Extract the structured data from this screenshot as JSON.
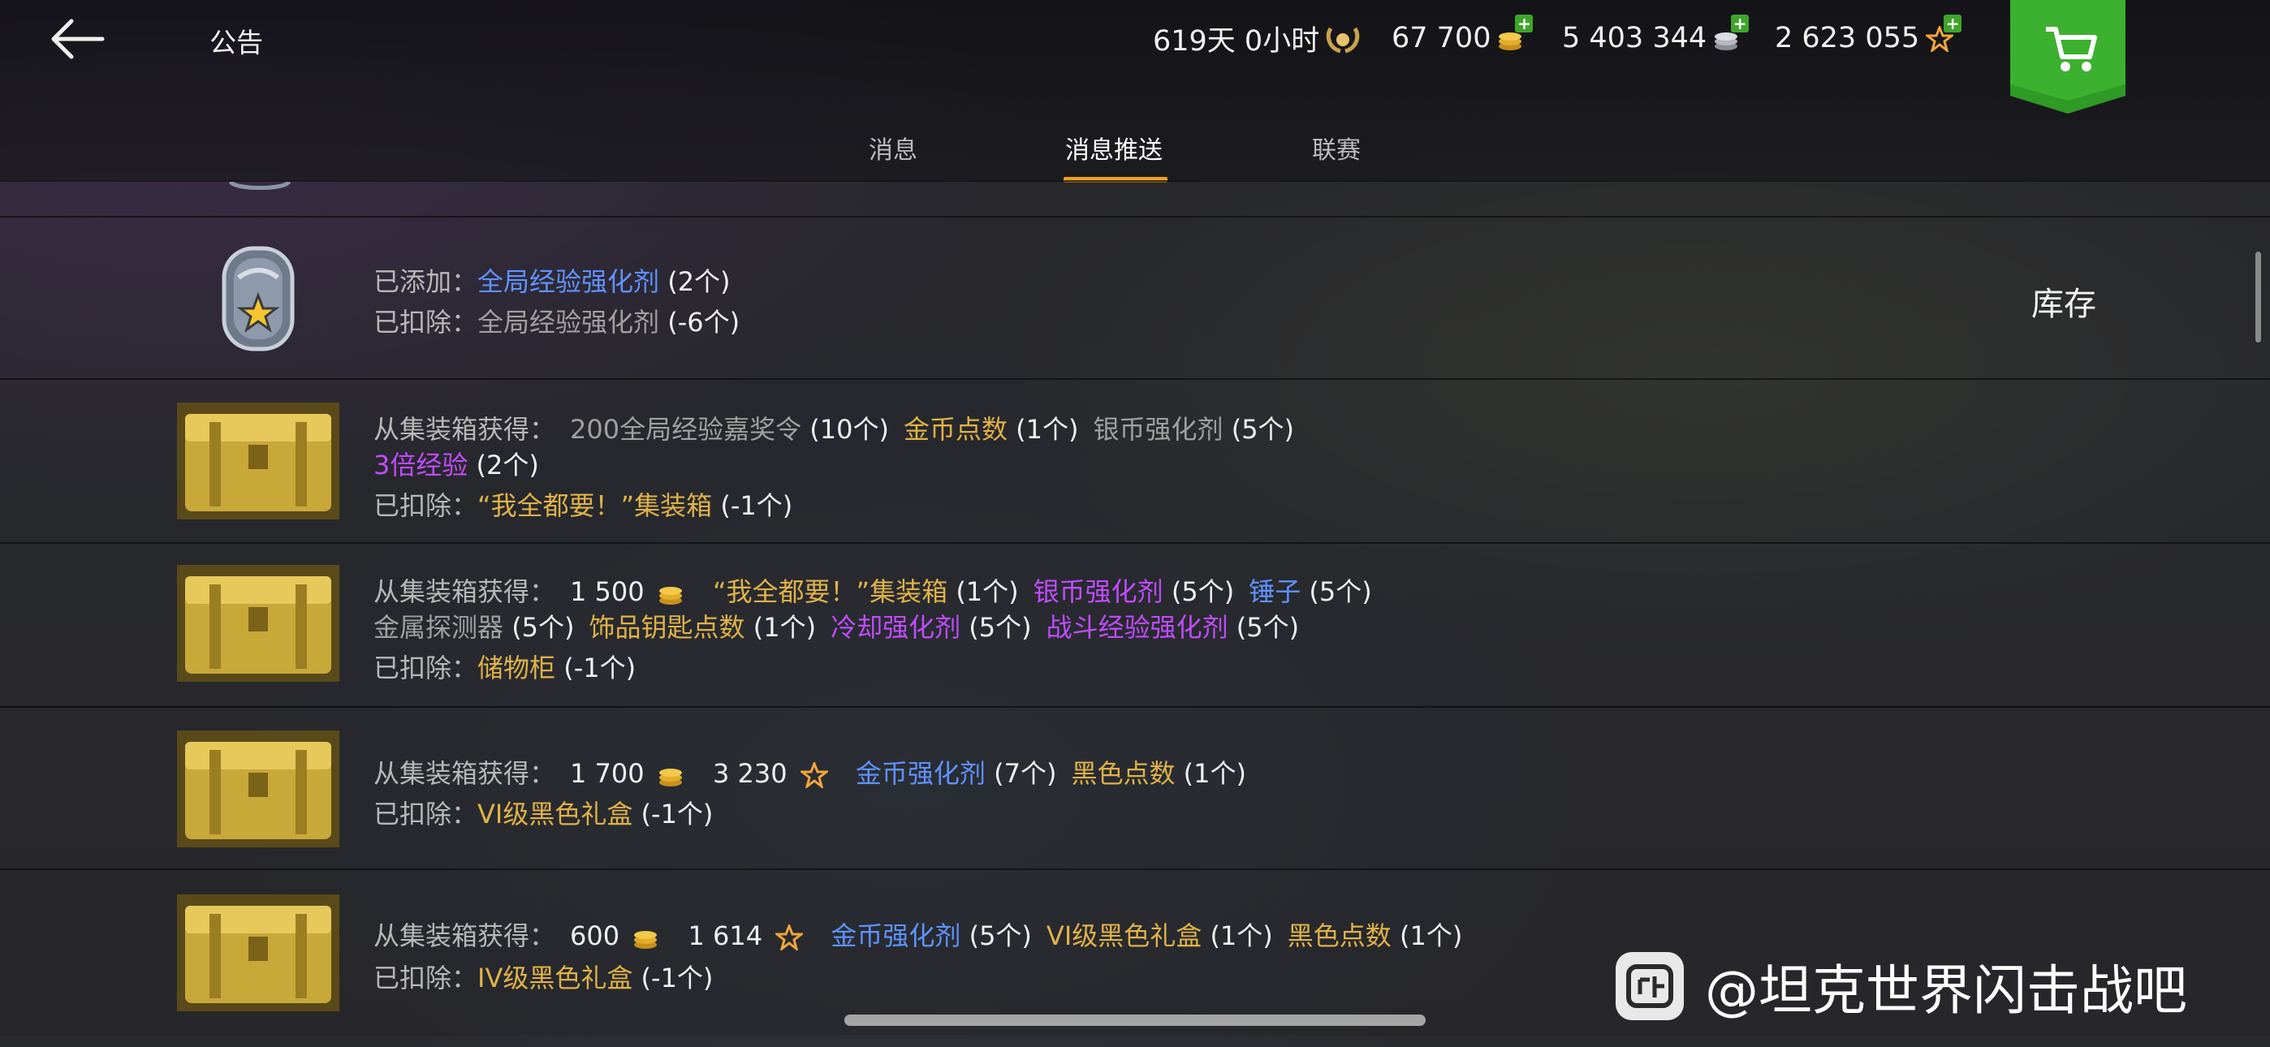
{
  "header": {
    "title": "公告",
    "resources": {
      "premium_time": "619天 0小时",
      "gold": "67 700",
      "silver": "5 403 344",
      "free_xp": "2 623 055"
    }
  },
  "tabs": [
    {
      "label": "消息",
      "active": false
    },
    {
      "label": "消息推送",
      "active": true
    },
    {
      "label": "联赛",
      "active": false
    }
  ],
  "inventory_button": "库存",
  "messages": [
    {
      "lines": [
        [
          {
            "t": "已添加：",
            "c": "lbl"
          },
          {
            "t": "全局经验强化剂",
            "c": "blue"
          },
          {
            "t": " (2个)",
            "c": "white"
          }
        ],
        [
          {
            "t": "已扣除：",
            "c": "lbl"
          },
          {
            "t": "全局经验强化剂",
            "c": "gray"
          },
          {
            "t": " (-6个)",
            "c": "white"
          }
        ]
      ]
    },
    {
      "lines": [
        [
          {
            "t": "从集装箱获得：",
            "c": "lbl"
          },
          {
            "t": "200全局经验嘉奖令",
            "c": "gray"
          },
          {
            "t": " (10个)",
            "c": "white"
          },
          {
            "t": "金币点数",
            "c": "yellow"
          },
          {
            "t": " (1个)",
            "c": "white"
          },
          {
            "t": "银币强化剂",
            "c": "gray"
          },
          {
            "t": " (5个)",
            "c": "white"
          }
        ],
        [
          {
            "t": "3倍经验",
            "c": "purple"
          },
          {
            "t": " (2个)",
            "c": "white"
          }
        ],
        [
          {
            "t": "已扣除：",
            "c": "lbl"
          },
          {
            "t": "“我全都要！”集装箱",
            "c": "yellow"
          },
          {
            "t": " (-1个)",
            "c": "white"
          }
        ]
      ]
    },
    {
      "lines": [
        [
          {
            "t": "从集装箱获得：",
            "c": "lbl"
          },
          {
            "t": "1 500",
            "c": "white",
            "coin": "gold"
          },
          {
            "t": "“我全都要！”集装箱",
            "c": "yellow"
          },
          {
            "t": " (1个)",
            "c": "white"
          },
          {
            "t": "银币强化剂",
            "c": "purple"
          },
          {
            "t": " (5个)",
            "c": "white"
          },
          {
            "t": "锤子",
            "c": "blue"
          },
          {
            "t": " (5个)",
            "c": "white"
          }
        ],
        [
          {
            "t": "金属探测器",
            "c": "gray"
          },
          {
            "t": " (5个)",
            "c": "white"
          },
          {
            "t": "饰品钥匙点数",
            "c": "yellow"
          },
          {
            "t": " (1个)",
            "c": "white"
          },
          {
            "t": "冷却强化剂",
            "c": "purple"
          },
          {
            "t": " (5个)",
            "c": "white"
          },
          {
            "t": "战斗经验强化剂",
            "c": "purple"
          },
          {
            "t": " (5个)",
            "c": "white"
          }
        ],
        [
          {
            "t": "已扣除：",
            "c": "lbl"
          },
          {
            "t": "储物柜",
            "c": "yellow"
          },
          {
            "t": " (-1个)",
            "c": "white"
          }
        ]
      ]
    },
    {
      "lines": [
        [
          {
            "t": "从集装箱获得：",
            "c": "lbl"
          },
          {
            "t": "1 700",
            "c": "white",
            "coin": "gold"
          },
          {
            "t": "3 230",
            "c": "white",
            "coin": "star"
          },
          {
            "t": "金币强化剂",
            "c": "blue"
          },
          {
            "t": " (7个)",
            "c": "white"
          },
          {
            "t": "黑色点数",
            "c": "yellow"
          },
          {
            "t": " (1个)",
            "c": "white"
          }
        ],
        [
          {
            "t": "已扣除：",
            "c": "lbl"
          },
          {
            "t": "VI级黑色礼盒",
            "c": "yellow"
          },
          {
            "t": " (-1个)",
            "c": "white"
          }
        ]
      ]
    },
    {
      "lines": [
        [
          {
            "t": "从集装箱获得：",
            "c": "lbl"
          },
          {
            "t": "600",
            "c": "white",
            "coin": "gold"
          },
          {
            "t": "1 614",
            "c": "white",
            "coin": "star"
          },
          {
            "t": "金币强化剂",
            "c": "blue"
          },
          {
            "t": " (5个)",
            "c": "white"
          },
          {
            "t": "VI级黑色礼盒",
            "c": "yellow"
          },
          {
            "t": " (1个)",
            "c": "white"
          },
          {
            "t": "黑色点数",
            "c": "yellow"
          },
          {
            "t": " (1个)",
            "c": "white"
          }
        ],
        [
          {
            "t": "已扣除：",
            "c": "lbl"
          },
          {
            "t": "IV级黑色礼盒",
            "c": "yellow"
          },
          {
            "t": " (-1个)",
            "c": "white"
          }
        ]
      ]
    }
  ],
  "watermark": "@坦克世界闪击战吧"
}
